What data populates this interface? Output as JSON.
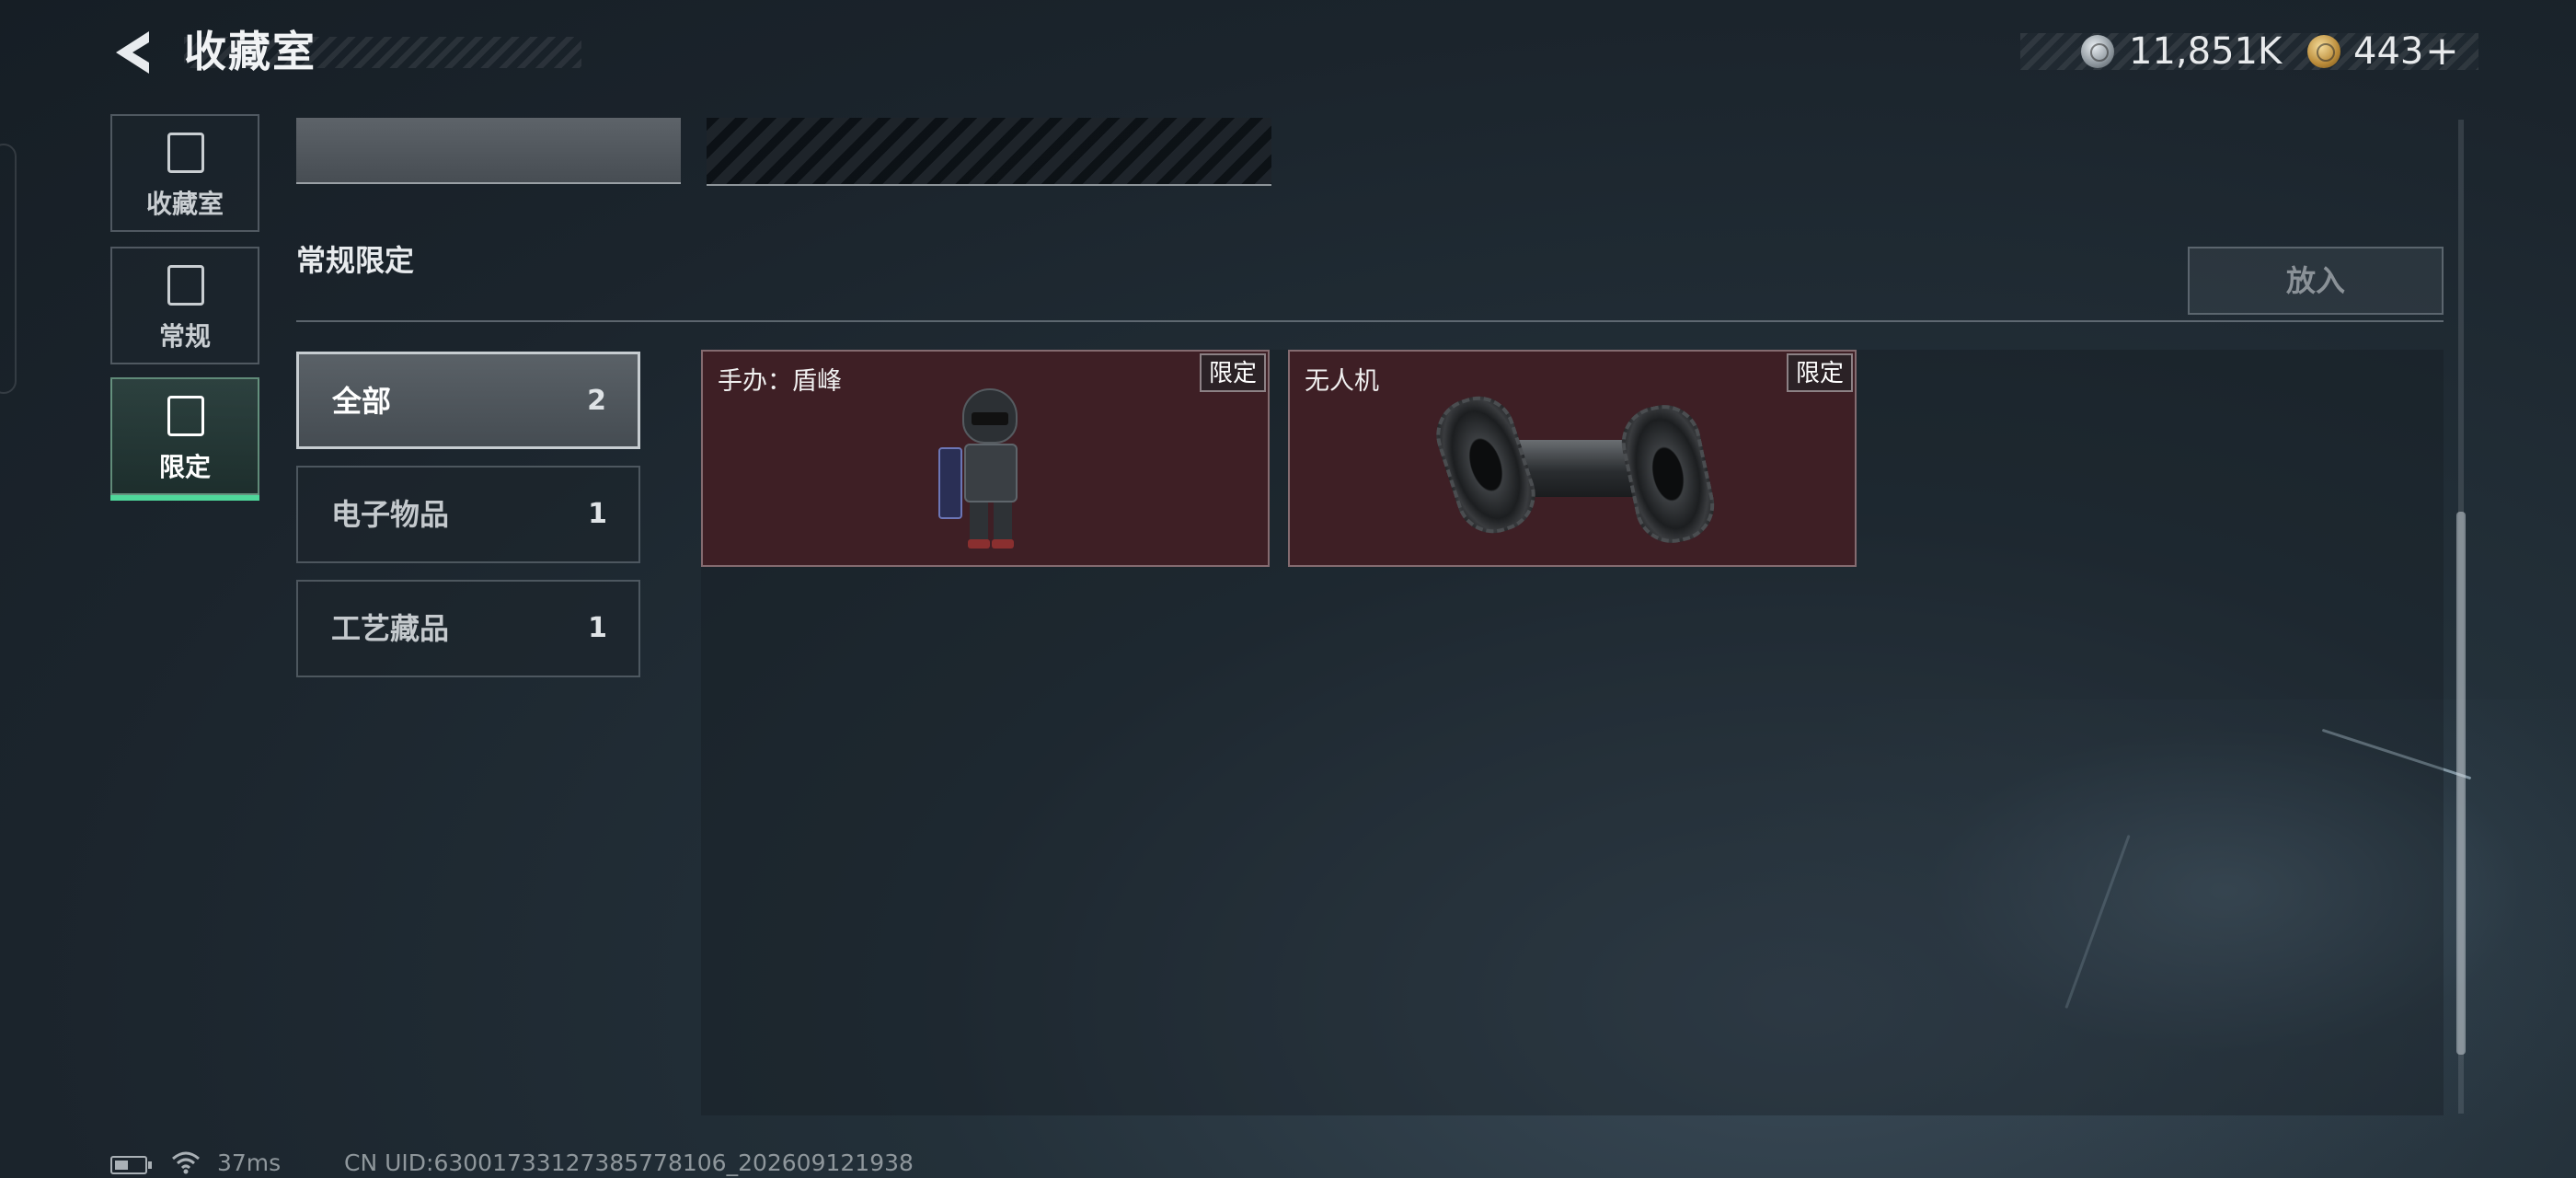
{
  "header": {
    "title": "收藏室",
    "currencies": [
      {
        "icon": "silver-coin-icon",
        "amount": "11,851K"
      },
      {
        "icon": "gold-coin-icon",
        "amount": "443"
      }
    ],
    "plus_label": "+"
  },
  "sidebar": {
    "items": [
      {
        "label": "收藏室",
        "icon": "collection-icon",
        "active": false
      },
      {
        "label": "常规",
        "icon": "regular-icon",
        "active": false
      },
      {
        "label": "限定",
        "icon": "limited-icon",
        "active": true
      }
    ],
    "active_color": "#4fd79a"
  },
  "section": {
    "title": "常规限定",
    "place_button": "放入"
  },
  "filters": [
    {
      "label": "全部",
      "count": "2",
      "active": true
    },
    {
      "label": "电子物品",
      "count": "1",
      "active": false
    },
    {
      "label": "工艺藏品",
      "count": "1",
      "active": false
    }
  ],
  "items": [
    {
      "name": "手办：盾峰",
      "badge": "限定",
      "art": "shield-figure"
    },
    {
      "name": "无人机",
      "badge": "限定",
      "art": "drone"
    }
  ],
  "footer": {
    "ping": "37ms",
    "uid": "CN UID:6300173312738577810​6_202609121938"
  },
  "colors": {
    "card_background": "#3e1f25",
    "accent": "#4fd79a"
  }
}
